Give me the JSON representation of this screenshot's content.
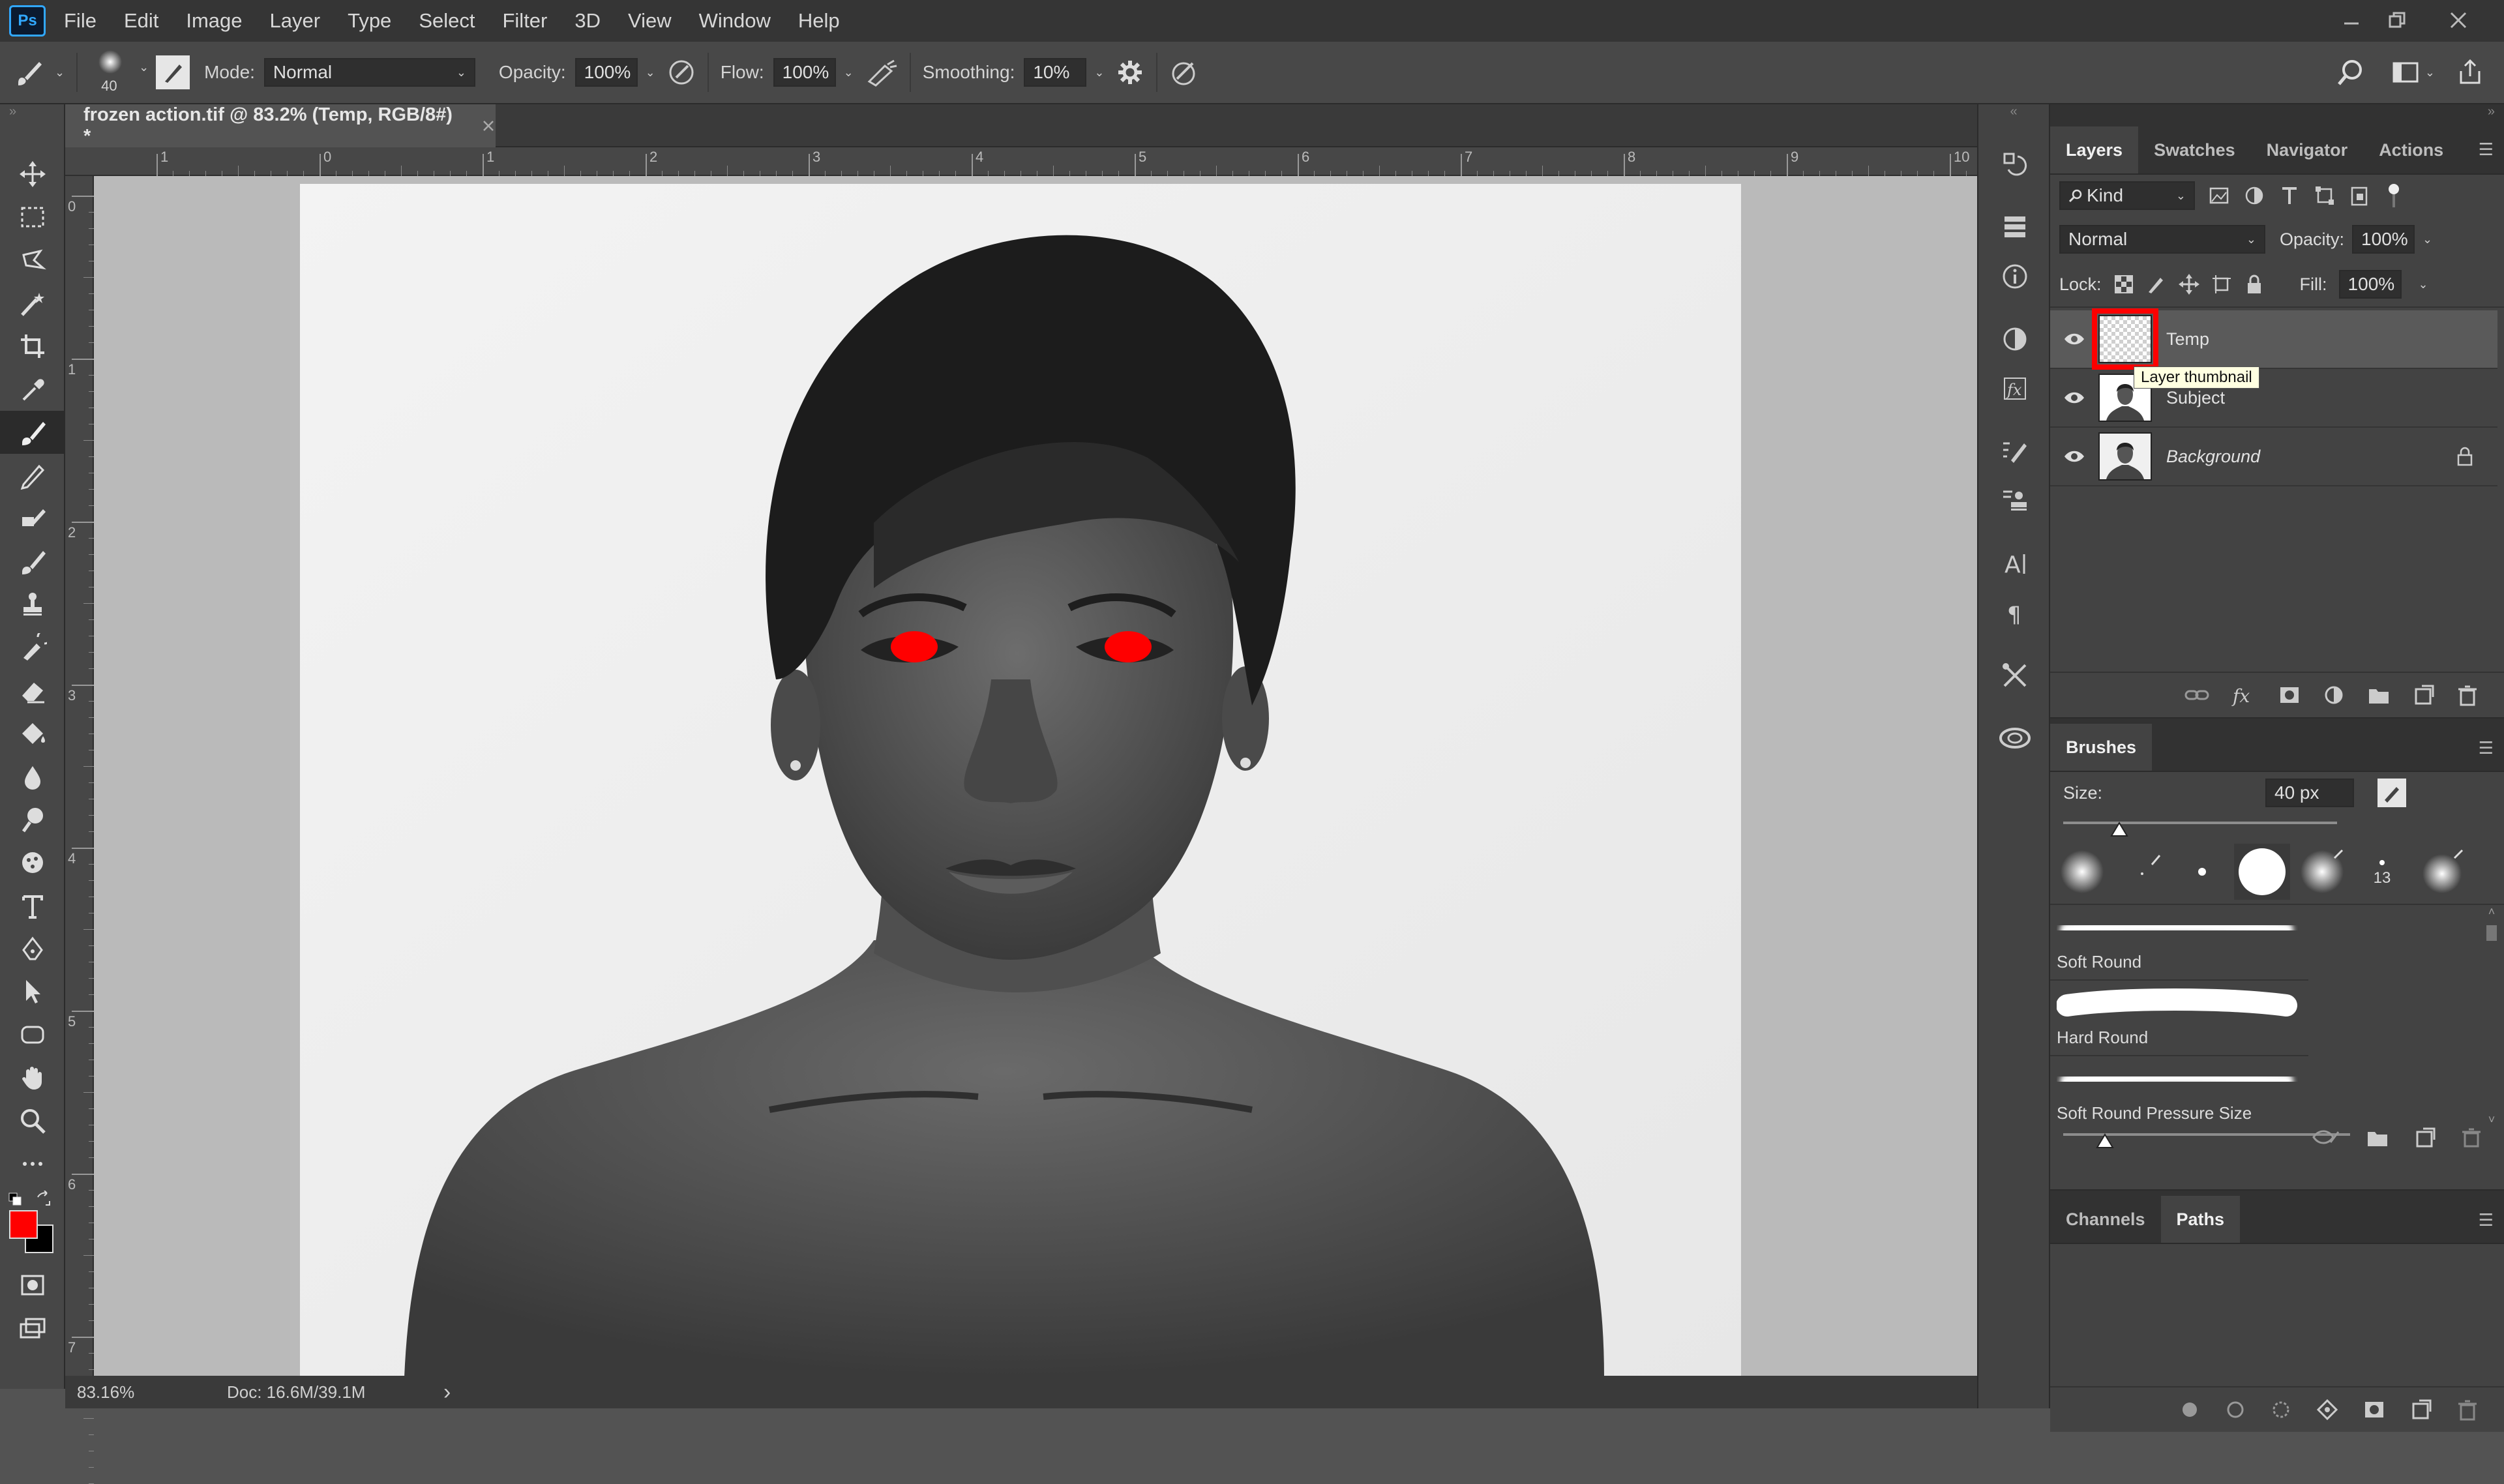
{
  "app": {
    "logo": "Ps"
  },
  "menu": [
    "File",
    "Edit",
    "Image",
    "Layer",
    "Type",
    "Select",
    "Filter",
    "3D",
    "View",
    "Window",
    "Help"
  ],
  "options": {
    "brush_size": "40",
    "mode_label": "Mode:",
    "mode_value": "Normal",
    "opacity_label": "Opacity:",
    "opacity_value": "100%",
    "flow_label": "Flow:",
    "flow_value": "100%",
    "smoothing_label": "Smoothing:",
    "smoothing_value": "10%"
  },
  "document": {
    "tab_title": "frozen action.tif @ 83.2% (Temp, RGB/8#) *",
    "ruler_top": [
      "1",
      "0",
      "1",
      "2",
      "3",
      "4",
      "5",
      "6",
      "7",
      "8",
      "9",
      "10"
    ],
    "ruler_left": [
      "0",
      "1",
      "2",
      "3",
      "4",
      "5",
      "6",
      "7"
    ]
  },
  "status": {
    "zoom": "83.16%",
    "doc": "Doc: 16.6M/39.1M",
    "arrow": "›"
  },
  "colors": {
    "foreground": "#ff0000",
    "background": "#000000",
    "highlight": "#ff0000"
  },
  "layers_panel": {
    "tabs": [
      "Layers",
      "Swatches",
      "Navigator",
      "Actions"
    ],
    "filter_kind": "Kind",
    "blend_mode": "Normal",
    "opacity_label": "Opacity:",
    "opacity_value": "100%",
    "lock_label": "Lock:",
    "fill_label": "Fill:",
    "fill_value": "100%",
    "layers": [
      {
        "name": "Temp",
        "selected": true
      },
      {
        "name": "Subject",
        "selected": false
      },
      {
        "name": "Background",
        "selected": false,
        "locked": true
      }
    ],
    "tooltip": "Layer thumbnail"
  },
  "brushes_panel": {
    "title": "Brushes",
    "size_label": "Size:",
    "size_value": "40 px",
    "small_label": "13",
    "presets": [
      "Soft Round",
      "Hard Round",
      "Soft Round Pressure Size"
    ]
  },
  "channels_panel": {
    "tabs": [
      "Channels",
      "Paths"
    ]
  }
}
